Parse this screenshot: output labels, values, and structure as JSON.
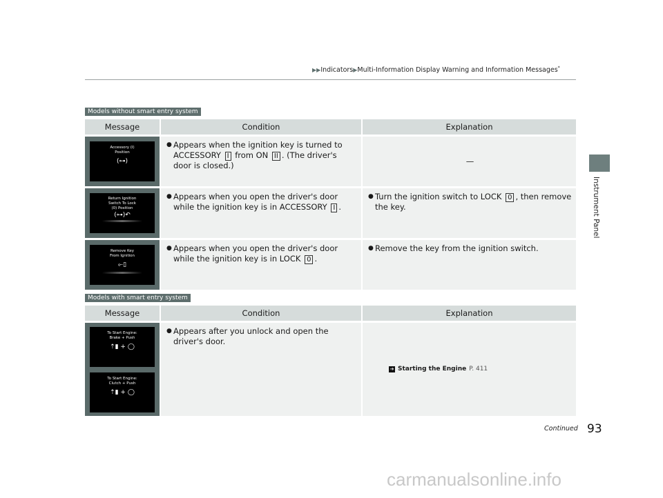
{
  "header": {
    "breadcrumb": [
      "Indicators",
      "Multi-Information Display Warning and Information Messages"
    ],
    "breadcrumb_mark": "*"
  },
  "side_tab": {
    "label": "Instrument Panel",
    "color": "#6e7f7e"
  },
  "sections": [
    {
      "tag": "Models without smart entry system",
      "columns": [
        "Message",
        "Condition",
        "Explanation"
      ],
      "rows": [
        {
          "screen": {
            "lines": [
              "Accessory (I)",
              "Position"
            ],
            "icon": "key-in-ignition-icon",
            "glyph": "(⊶)"
          },
          "condition": {
            "pre": "Appears when the ignition key is turned to ACCESSORY",
            "key1": "I",
            "mid": "from ON",
            "key2": "II",
            "post": ". (The driver's door is closed.)"
          },
          "explanation": "—"
        },
        {
          "screen": {
            "lines": [
              "Return Ignition",
              "Switch To Lock",
              "(0) Position"
            ],
            "icon": "key-turn-icon",
            "glyph": "(⊶)↶"
          },
          "condition": {
            "pre": "Appears when you open the driver's door while the ignition key is in ACCESSORY",
            "key1": "I",
            "post": "."
          },
          "explanation": {
            "pre": "Turn the ignition switch to LOCK",
            "key": "0",
            "post": ", then remove the key."
          }
        },
        {
          "screen": {
            "lines": [
              "Remove Key",
              "From Ignition"
            ],
            "icon": "key-remove-icon",
            "glyph": "⟜▯"
          },
          "condition": {
            "pre": "Appears when you open the driver's door while the ignition key is in LOCK",
            "key1": "0",
            "post": "."
          },
          "explanation": {
            "text": "Remove the key from the ignition switch."
          }
        }
      ]
    },
    {
      "tag": "Models with smart entry system",
      "columns": [
        "Message",
        "Condition",
        "Explanation"
      ],
      "rows": [
        {
          "screens": [
            {
              "lines": [
                "To Start Engine:",
                "Brake + Push"
              ],
              "icon": "brake-push-icon",
              "glyph": "⇡▮ + ◯"
            },
            {
              "lines": [
                "To Start Engine:",
                "Clutch + Push"
              ],
              "icon": "clutch-push-icon",
              "glyph": "⇡▮ + ◯"
            }
          ],
          "condition": {
            "text": "Appears after you unlock and open the driver's door."
          },
          "explanation": {
            "ref_title": "Starting the Engine",
            "ref_page": "P. 411"
          }
        }
      ]
    }
  ],
  "footer": {
    "continued": "Continued",
    "page_number": "93",
    "watermark": "carmanualsonline.info"
  }
}
